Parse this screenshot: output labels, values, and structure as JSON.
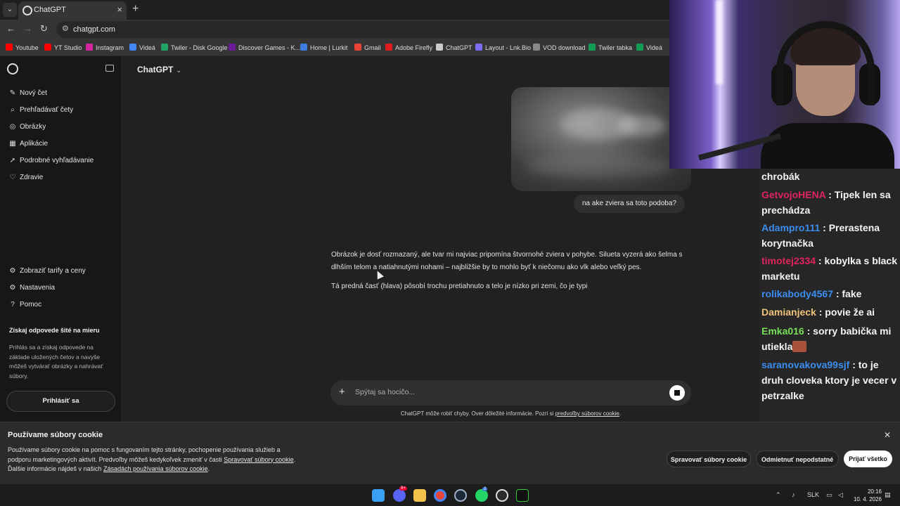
{
  "browser": {
    "tab_title": "ChatGPT",
    "url": "chatgpt.com",
    "bookmarks": [
      {
        "label": "Youtube",
        "color": "#ff0000"
      },
      {
        "label": "YT Studio",
        "color": "#ff0000"
      },
      {
        "label": "Instagram",
        "color": "#d6249f"
      },
      {
        "label": "Videá",
        "color": "#4285f4"
      },
      {
        "label": "Twiler - Disk Google",
        "color": "#1fa463"
      },
      {
        "label": "Discover Games - K...",
        "color": "#6a1b9a"
      },
      {
        "label": "Home | Lurkit",
        "color": "#3f7de0"
      },
      {
        "label": "Gmail",
        "color": "#ea4335"
      },
      {
        "label": "Adobe Firefly",
        "color": "#e21c1c"
      },
      {
        "label": "ChatGPT",
        "color": "#cccccc"
      },
      {
        "label": "Layout - Lnk.Bio",
        "color": "#7c6cf2"
      },
      {
        "label": "VOD download",
        "color": "#888888"
      },
      {
        "label": "Twiler tabka",
        "color": "#0f9d58"
      },
      {
        "label": "Videá",
        "color": "#0f9d58"
      }
    ]
  },
  "sidebar": {
    "items": [
      {
        "label": "Nový čet",
        "icon": "✎"
      },
      {
        "label": "Prehľadávať čety",
        "icon": "⌕"
      },
      {
        "label": "Obrázky",
        "icon": "◎"
      },
      {
        "label": "Aplikácie",
        "icon": "▦"
      },
      {
        "label": "Podrobné vyhľadávanie",
        "icon": "➚"
      },
      {
        "label": "Zdravie",
        "icon": "♡"
      }
    ],
    "bottom_items": [
      {
        "label": "Zobraziť tarify a ceny",
        "icon": "⚙"
      },
      {
        "label": "Nastavenia",
        "icon": "⚙"
      },
      {
        "label": "Pomoc",
        "icon": "?"
      }
    ],
    "promo_title": "Získaj odpovede šité na mieru",
    "promo_body": "Prihlás sa a získaj odpovede na základe uložených četov a navyše môžeš vytvárať obrázky a nahrávať súbory.",
    "login_label": "Prihlásiť sa"
  },
  "main": {
    "model_label": "ChatGPT",
    "user_message": "na ake zviera sa toto podoba?",
    "reply_p1": "Obrázok je dosť rozmazaný, ale tvar mi najviac pripomína štvornohé zviera v pohybe. Silueta vyzerá ako šelma s dlhším telom a natiahnutými nohami – najbližšie by to mohlo byť k niečomu ako vlk alebo veľký pes.",
    "reply_p2": "Tá predná časť (hlava) pôsobí trochu pretiahnuto a telo je nízko pri zemi, čo je typi",
    "composer_placeholder": "Spýtaj sa hocičo...",
    "disclaimer_text": "ChatGPT môže robiť chyby. Over dôležité informácie. Pozri si ",
    "disclaimer_link": "predvoľby súborov cookie",
    "disclaimer_end": "."
  },
  "cookie": {
    "title": "Používame súbory cookie",
    "body_1": "Používame súbory cookie na pomoc s fungovaním tejto stránky, pochopenie používania služieb a podporu marketingových aktivít. Predvoľby môžeš kedykoľvek zmeniť v časti ",
    "link_1": "Spravovať súbory cookie",
    "body_2": ". Ďalšie informácie nájdeš v našich ",
    "link_2": "Zásadách používania súborov cookie",
    "body_3": ".",
    "btn_manage": "Spravovať súbory cookie",
    "btn_reject": "Odmietnuť nepodstatné",
    "btn_accept": "Prijať všetko"
  },
  "taskbar": {
    "lang": "SLK",
    "time": "20:16",
    "date": "10. 4. 2026",
    "discord_badge": "9+",
    "whatsapp_badge": "2"
  },
  "chat": {
    "messages": [
      {
        "user": "",
        "color": "#ffffff",
        "text": "chrobák"
      },
      {
        "user": "GetvojoHENA",
        "color": "#e0245e",
        "text": " : Tipek len sa prechádza"
      },
      {
        "user": "Adampro111",
        "color": "#3b8df0",
        "text": " : Prerastena korytnačka"
      },
      {
        "user": "timotej2334",
        "color": "#e0245e",
        "text": " : kobylka s black marketu"
      },
      {
        "user": "rolikabody4567",
        "color": "#3b8df0",
        "text": " : fake"
      },
      {
        "user": "Damianjeck",
        "color": "#f0c27a",
        "text": " : povie že ai"
      },
      {
        "user": "Emka016",
        "color": "#78e05a",
        "text": " : sorry babička mi utiekla"
      },
      {
        "user": "saranovakova99sjf",
        "color": "#3b8df0",
        "text": " : to je druh cloveka ktory je vecer v petrzalke"
      }
    ]
  }
}
